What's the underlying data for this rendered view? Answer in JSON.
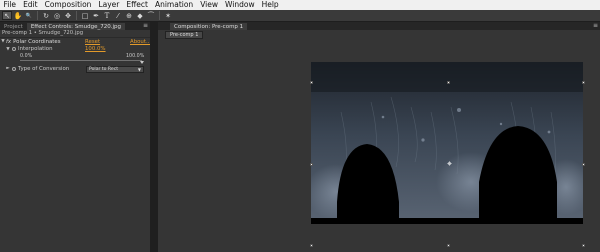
{
  "menu": [
    "File",
    "Edit",
    "Composition",
    "Layer",
    "Effect",
    "Animation",
    "View",
    "Window",
    "Help"
  ],
  "toolbar": {
    "icons": [
      "pointer-icon",
      "hand-icon",
      "zoom-icon",
      "rotate-icon",
      "camera-orbit-icon",
      "pan-behind-icon",
      "rectangle-mask-icon",
      "pen-icon",
      "type-icon",
      "brush-icon",
      "clone-stamp-icon",
      "eraser-icon",
      "roto-brush-icon",
      "puppet-pin-icon"
    ],
    "glyphs": [
      "↖",
      "✋",
      "🔍",
      "↻",
      "◎",
      "✥",
      "□",
      "✒",
      "T",
      "⁄",
      "⊕",
      "◆",
      "⁀",
      "✶"
    ]
  },
  "left_panel": {
    "tabs": [
      "Project",
      "Effect Controls: Smudge_720.jpg"
    ],
    "panel_menu": "≡",
    "subtitle": "Pre-comp 1 • Smudge_720.jpg",
    "effect": {
      "name": "Polar Coordinates",
      "reset": "Reset",
      "about": "About...",
      "interpolation_label": "Interpolation",
      "interpolation_value": "100.0%",
      "slider_min": "0.0%",
      "slider_max": "100.0%",
      "slider_fraction": 1.0,
      "conversion_label": "Type of Conversion",
      "conversion_value": "Polar to Rect"
    }
  },
  "comp_panel": {
    "tab": "Composition: Pre-comp 1",
    "panel_menu": "≡",
    "flow_button": "Pre-comp 1"
  },
  "colors": {
    "accent_orange": "#e39a2a",
    "panel_bg": "#353535",
    "menubar_bg": "#f0f0f0"
  }
}
